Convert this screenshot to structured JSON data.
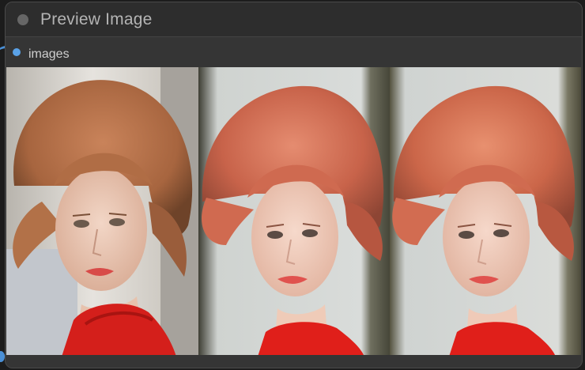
{
  "node": {
    "title": "Preview Image",
    "input": {
      "label": "images",
      "color": "#5aa2e8"
    }
  },
  "colors": {
    "node_bg": "#353535",
    "header_bg": "#2d2d2d",
    "wire": "#4a8fd6"
  },
  "preview": {
    "image_count": 3
  }
}
